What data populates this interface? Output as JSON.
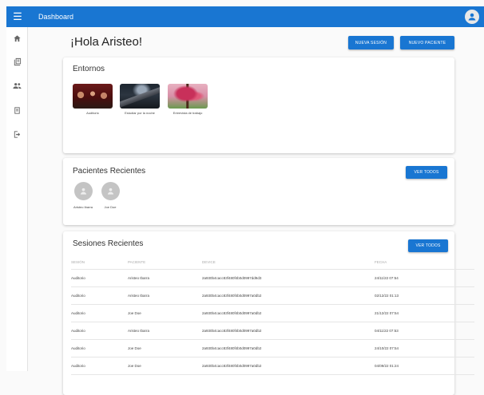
{
  "appbar": {
    "title": "Dashboard",
    "menu_icon": "menu-icon",
    "avatar_icon": "account-circle-icon",
    "color": "#1976d2"
  },
  "sidebar": {
    "items": [
      {
        "icon": "home-icon"
      },
      {
        "icon": "library-icon"
      },
      {
        "icon": "people-icon"
      },
      {
        "icon": "sessions-icon"
      },
      {
        "icon": "logout-icon"
      }
    ]
  },
  "header": {
    "greeting": "¡Hola Aristeo!",
    "new_session_label": "Nueva sesión",
    "new_patient_label": "Nuevo paciente"
  },
  "environments": {
    "title": "Entornos",
    "items": [
      {
        "label": "Auditorio"
      },
      {
        "label": "Estudiar por la noche"
      },
      {
        "label": "Entrevista de trabajo"
      }
    ]
  },
  "patients": {
    "title": "Pacientes Recientes",
    "view_all_label": "Ver todos",
    "items": [
      {
        "name": "Aristeo Ibarra"
      },
      {
        "name": "Joe Doe"
      }
    ]
  },
  "sessions": {
    "title": "Sesiones Recientes",
    "view_all_label": "Ver todos",
    "columns": [
      "Sesión",
      "Paciente",
      "Device",
      "Fecha"
    ],
    "rows": [
      [
        "Auditorio",
        "Aristeo Ibarra",
        "2a930b4cacc83f480f4b0d0997dd9d3",
        "24/11/22 07:54"
      ],
      [
        "Auditorio",
        "Aristeo Ibarra",
        "2a930b4cacc83f480f4b0d0997a0db2",
        "02/12/22 01:13"
      ],
      [
        "Auditorio",
        "Joe Doe",
        "2a930b4cacc83f480f4b0d0997a0db2",
        "21/12/22 07:54"
      ],
      [
        "Auditorio",
        "Aristeo Ibarra",
        "2a930b4cacc83f480f4b0d0997a0db2",
        "04/11/22 07:53"
      ],
      [
        "Auditorio",
        "Joe Doe",
        "2a930b4cacc83f480f4b0d0997a0db2",
        "24/10/22 07:54"
      ],
      [
        "Auditorio",
        "Joe Doe",
        "2a930b4cacc83f480f4b0d0997a0db2",
        "04/09/22 01:24"
      ]
    ]
  }
}
